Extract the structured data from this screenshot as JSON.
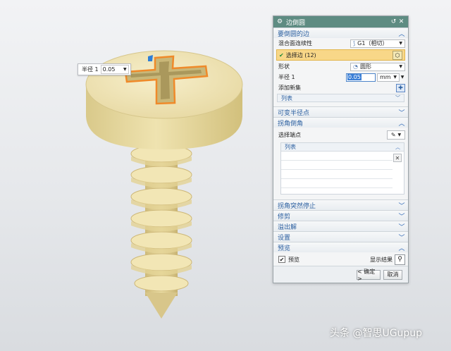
{
  "float_tag": {
    "label": "半径 1",
    "value": "0.05"
  },
  "dialog": {
    "title": "边倒圆",
    "title_icon": "gear-icon",
    "sections": {
      "edges": {
        "header": "要倒圆的边",
        "continuity_label": "混合面连续性",
        "continuity_value": "G1（相切）",
        "select_label": "选择边 (12)",
        "shape_label": "形状",
        "shape_value": "圆形",
        "radius_label": "半径 1",
        "radius_value": "0.05",
        "radius_unit": "mm",
        "add_set_label": "添加新集",
        "list_label": "列表"
      },
      "variable_radius": {
        "header": "可变半径点"
      },
      "corner": {
        "header": "拐角倒角",
        "endpoint_label": "选择端点",
        "list_label": "列表"
      },
      "corner_stop": {
        "header": "拐角突然停止"
      },
      "trim": {
        "header": "修剪"
      },
      "overflow": {
        "header": "溢出解"
      },
      "settings": {
        "header": "设置"
      },
      "preview": {
        "header": "预览",
        "preview_label": "预览",
        "preview_checked": true,
        "show_result_label": "显示结果"
      }
    },
    "buttons": {
      "ok": "< 确定 >",
      "cancel": "取消"
    }
  },
  "watermark": "头条 @智思UGupup",
  "colors": {
    "title_bar": "#5e8c82",
    "selection": "#f8d788",
    "accent": "#2b5fa0",
    "screw": "#eadb9c"
  }
}
